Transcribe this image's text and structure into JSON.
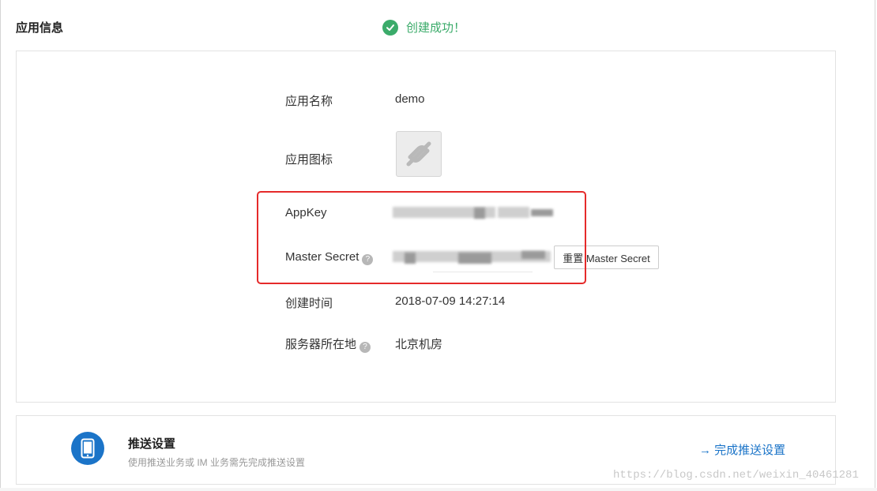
{
  "header": {
    "title": "应用信息",
    "success_message": "创建成功！"
  },
  "app_info": {
    "name_label": "应用名称",
    "name_value": "demo",
    "icon_label": "应用图标",
    "appkey_label": "AppKey",
    "appkey_value_visible": "117e7",
    "master_secret_label": "Master Secret",
    "master_secret_value_visible": "f2174 ... 0662 ... 32",
    "reset_button_label": "重置 Master Secret",
    "created_time_label": "创建时间",
    "created_time_value": "2018-07-09 14:27:14",
    "server_location_label": "服务器所在地",
    "server_location_value": "北京机房",
    "help_glyph": "?"
  },
  "push_settings": {
    "title": "推送设置",
    "description": "使用推送业务或 IM 业务需先完成推送设置",
    "link_label": "完成推送设置",
    "link_arrow": "→"
  },
  "watermark": "https://blog.csdn.net/weixin_40461281",
  "colors": {
    "success": "#3bab6a",
    "highlight": "#e52a2a",
    "link": "#1b74c8"
  },
  "icons": [
    "check-circle-icon",
    "app-placeholder-icon",
    "help-icon",
    "phone-icon",
    "arrow-right-icon"
  ]
}
